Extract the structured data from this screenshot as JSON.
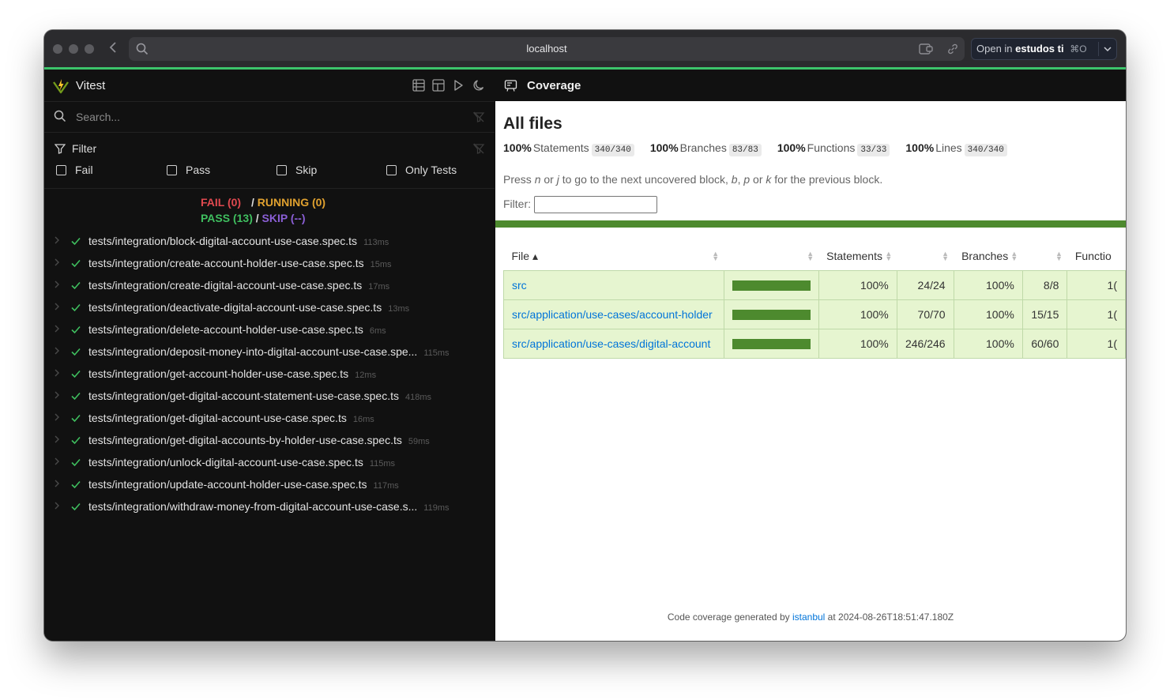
{
  "browser": {
    "url": "localhost",
    "open_in_prefix": "Open in",
    "open_in_app": "estudos ti",
    "open_in_shortcut": "⌘O"
  },
  "vitest": {
    "title": "Vitest",
    "search_placeholder": "Search...",
    "filter_title": "Filter",
    "filters": [
      "Fail",
      "Pass",
      "Skip",
      "Only Tests"
    ],
    "summary": {
      "fail": "FAIL (0)",
      "running": "RUNNING (0)",
      "pass": "PASS (13)",
      "skip": "SKIP (--)",
      "separator": "/"
    },
    "tests": [
      {
        "name": "tests/integration/block-digital-account-use-case.spec.ts",
        "duration": "113ms"
      },
      {
        "name": "tests/integration/create-account-holder-use-case.spec.ts",
        "duration": "15ms"
      },
      {
        "name": "tests/integration/create-digital-account-use-case.spec.ts",
        "duration": "17ms"
      },
      {
        "name": "tests/integration/deactivate-digital-account-use-case.spec.ts",
        "duration": "13ms"
      },
      {
        "name": "tests/integration/delete-account-holder-use-case.spec.ts",
        "duration": "6ms"
      },
      {
        "name": "tests/integration/deposit-money-into-digital-account-use-case.spe...",
        "duration": "115ms"
      },
      {
        "name": "tests/integration/get-account-holder-use-case.spec.ts",
        "duration": "12ms"
      },
      {
        "name": "tests/integration/get-digital-account-statement-use-case.spec.ts",
        "duration": "418ms"
      },
      {
        "name": "tests/integration/get-digital-account-use-case.spec.ts",
        "duration": "16ms"
      },
      {
        "name": "tests/integration/get-digital-accounts-by-holder-use-case.spec.ts",
        "duration": "59ms"
      },
      {
        "name": "tests/integration/unlock-digital-account-use-case.spec.ts",
        "duration": "115ms"
      },
      {
        "name": "tests/integration/update-account-holder-use-case.spec.ts",
        "duration": "117ms"
      },
      {
        "name": "tests/integration/withdraw-money-from-digital-account-use-case.s...",
        "duration": "119ms"
      }
    ]
  },
  "coverage": {
    "panel_title": "Coverage",
    "heading": "All files",
    "stats": [
      {
        "pct": "100%",
        "label": "Statements",
        "frac": "340/340"
      },
      {
        "pct": "100%",
        "label": "Branches",
        "frac": "83/83"
      },
      {
        "pct": "100%",
        "label": "Functions",
        "frac": "33/33"
      },
      {
        "pct": "100%",
        "label": "Lines",
        "frac": "340/340"
      }
    ],
    "hint": {
      "t1": "Press ",
      "k1": "n",
      "t2": " or ",
      "k2": "j",
      "t3": " to go to the next uncovered block, ",
      "k3": "b",
      "t4": ", ",
      "k4": "p",
      "t5": " or ",
      "k5": "k",
      "t6": " for the previous block."
    },
    "filter_label": "Filter:",
    "columns": {
      "file": "File ▴",
      "statements": "Statements",
      "branches": "Branches",
      "functions": "Functio"
    },
    "rows": [
      {
        "file": "src",
        "coverage_pct": 100,
        "stmt_pct": "100%",
        "stmt_frac": "24/24",
        "branch_pct": "100%",
        "branch_frac": "8/8",
        "func_pct": "1("
      },
      {
        "file": "src/application/use-cases/account-holder",
        "coverage_pct": 100,
        "stmt_pct": "100%",
        "stmt_frac": "70/70",
        "branch_pct": "100%",
        "branch_frac": "15/15",
        "func_pct": "1("
      },
      {
        "file": "src/application/use-cases/digital-account",
        "coverage_pct": 100,
        "stmt_pct": "100%",
        "stmt_frac": "246/246",
        "branch_pct": "100%",
        "branch_frac": "60/60",
        "func_pct": "1("
      }
    ],
    "footer": {
      "prefix": "Code coverage generated by ",
      "tool": "istanbul",
      "suffix": " at 2024-08-26T18:51:47.180Z"
    }
  },
  "colors": {
    "accent_green": "#3cc46b",
    "coverage_bar": "#4d8a2e",
    "fail": "#e0494f",
    "running": "#e0a12f",
    "pass": "#3fbf5f",
    "skip": "#8b5fd6"
  }
}
